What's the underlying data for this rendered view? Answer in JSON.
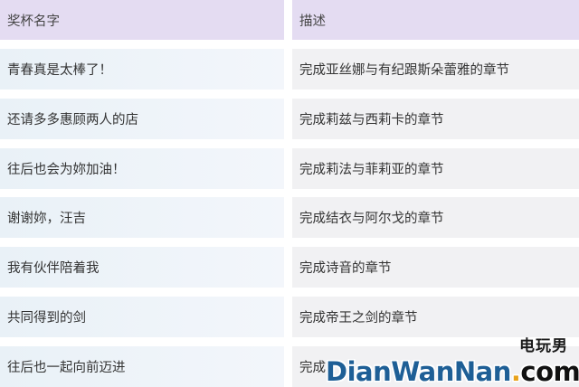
{
  "table": {
    "headers": [
      "奖杯名字",
      "描述"
    ],
    "rows": [
      {
        "name": "青春真是太棒了！",
        "desc": "完成亚丝娜与有纪跟斯朵蕾雅的章节"
      },
      {
        "name": "还请多多惠顾两人的店",
        "desc": "完成莉兹与西莉卡的章节"
      },
      {
        "name": "往后也会为妳加油！",
        "desc": "完成莉法与菲莉亚的章节"
      },
      {
        "name": "谢谢妳，汪吉",
        "desc": "完成结衣与阿尔戈的章节"
      },
      {
        "name": "我有伙伴陪着我",
        "desc": "完成诗音的章节"
      },
      {
        "name": "共同得到的剑",
        "desc": "完成帝王之剑的章节"
      },
      {
        "name": "往后也一起向前迈进",
        "desc": "完成"
      }
    ]
  },
  "watermark": {
    "cn": "电玩男",
    "en_part1": "DianWanNan",
    "en_dot": ".",
    "en_part2": "com"
  },
  "colors": {
    "header_bg": "#e4dcf2",
    "name_cell_bg": "#e9f1f7",
    "desc_cell_bg": "#f1f1f3",
    "watermark_blue": "#1e5f96"
  }
}
